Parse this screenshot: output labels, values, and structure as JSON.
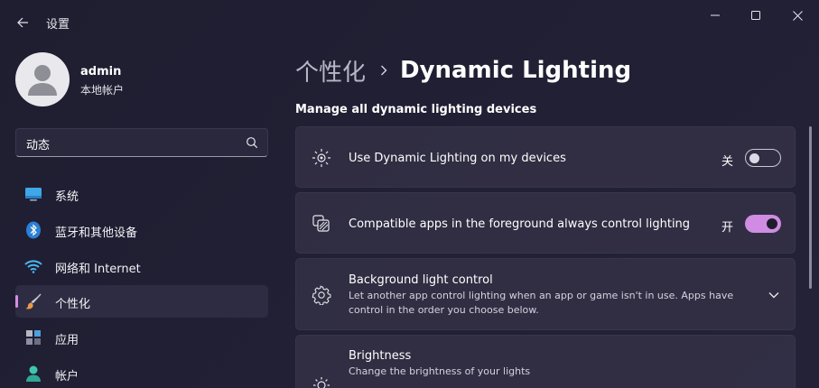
{
  "window": {
    "app_title": "设置"
  },
  "user": {
    "name": "admin",
    "account_type": "本地帐户"
  },
  "search": {
    "value": "动态"
  },
  "sidebar": {
    "items": [
      {
        "label": "系统",
        "icon": "monitor-icon"
      },
      {
        "label": "蓝牙和其他设备",
        "icon": "bluetooth-icon"
      },
      {
        "label": "网络和 Internet",
        "icon": "wifi-icon"
      },
      {
        "label": "个性化",
        "icon": "paintbrush-icon",
        "selected": true
      },
      {
        "label": "应用",
        "icon": "apps-icon"
      },
      {
        "label": "帐户",
        "icon": "person-icon"
      }
    ]
  },
  "main": {
    "breadcrumb_parent": "个性化",
    "breadcrumb_current": "Dynamic Lighting",
    "section_title": "Manage all dynamic lighting devices",
    "settings": [
      {
        "label": "Use Dynamic Lighting on my devices",
        "state_text": "关",
        "on": false,
        "icon": "sun-rays-icon"
      },
      {
        "label": "Compatible apps in the foreground always control lighting",
        "state_text": "开",
        "on": true,
        "icon": "layered-apps-icon"
      },
      {
        "label": "Background light control",
        "description": "Let another app control lighting when an app or game isn't in use. Apps have control in the order you choose below.",
        "icon": "gear-icon",
        "expandable": true
      },
      {
        "label": "Brightness",
        "description": "Change the brightness of your lights",
        "icon": "brightness-icon"
      }
    ]
  },
  "colors": {
    "accent": "#cf8ce2",
    "background": "#1f1d30",
    "card": "#34324a"
  }
}
